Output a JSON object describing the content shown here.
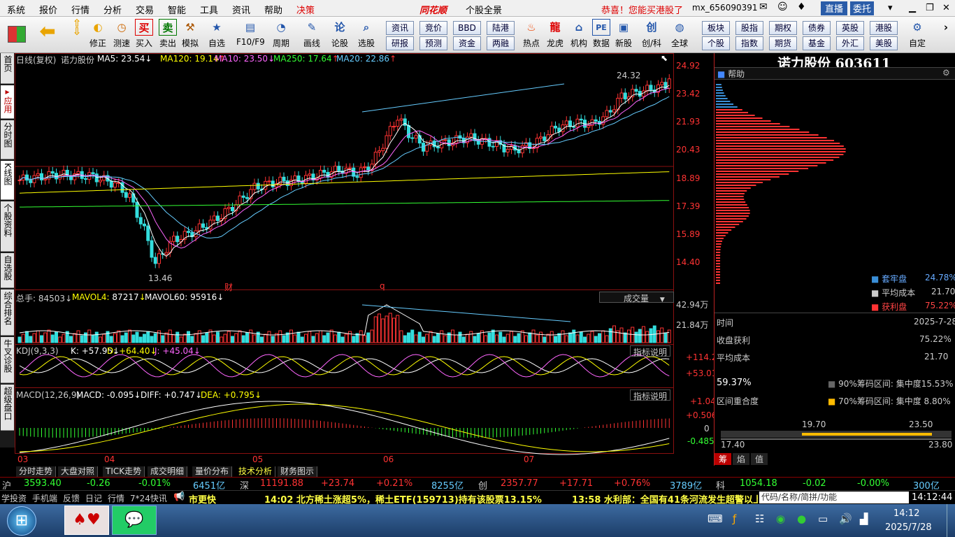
{
  "menu": {
    "items": [
      "系统",
      "报价",
      "行情",
      "分析",
      "交易",
      "智能",
      "工具",
      "资讯",
      "帮助",
      "决策"
    ],
    "brand": "同花顺",
    "sub": "个股全景",
    "promo": "恭喜！您能买港股了",
    "user": "mx_656090391",
    "buttons": [
      "直播",
      "委托"
    ]
  },
  "toolbar": {
    "big": [
      {
        "id": "back",
        "label": ""
      },
      {
        "id": "updown",
        "label": ""
      },
      {
        "id": "fix",
        "label": "修正"
      },
      {
        "id": "speed",
        "label": "测速"
      },
      {
        "id": "buy",
        "label": "买入"
      },
      {
        "id": "sell",
        "label": "卖出"
      },
      {
        "id": "sim",
        "label": "模拟"
      },
      {
        "id": "fav",
        "label": "自选"
      },
      {
        "id": "f10",
        "label": "F10/F9"
      },
      {
        "id": "period",
        "label": "周期"
      },
      {
        "id": "draw",
        "label": "画线"
      },
      {
        "id": "lungu",
        "label": "论股"
      },
      {
        "id": "pick",
        "label": "选股"
      }
    ],
    "grid": [
      [
        "资讯",
        "竞价",
        "BBD",
        "陆港"
      ],
      [
        "研报",
        "预测",
        "资金",
        "两融"
      ]
    ],
    "icons2": [
      {
        "id": "hot",
        "label": "热点"
      },
      {
        "id": "tiger",
        "label": "龙虎"
      },
      {
        "id": "org",
        "label": "机构"
      },
      {
        "id": "data",
        "label": "数据"
      },
      {
        "id": "newstock",
        "label": "新股"
      },
      {
        "id": "chuang",
        "label": "创/科"
      },
      {
        "id": "global",
        "label": "全球"
      }
    ],
    "grid2": [
      [
        "板块",
        "股指",
        "期权",
        "债券",
        "英股",
        "港股"
      ],
      [
        "个股",
        "指数",
        "期货",
        "基金",
        "外汇",
        "美股"
      ]
    ],
    "custom": "自定"
  },
  "sidetabs": [
    "首页",
    "应用",
    "分时图",
    "K线图",
    "个股资料",
    "自选股",
    "综合排名",
    "牛叉诊股",
    "超级盘口"
  ],
  "stock": {
    "title": "诺力股份 603611"
  },
  "chart": {
    "head": {
      "type": "日线(复权)",
      "name": "诺力股份",
      "ma": [
        {
          "k": "MA5",
          "v": "23.54",
          "c": "#ffffff"
        },
        {
          "k": "MA120",
          "v": "19.14",
          "c": "#ffff00"
        },
        {
          "k": "MA10",
          "v": "23.50",
          "c": "#ff66ff"
        },
        {
          "k": "MA250",
          "v": "17.64",
          "c": "#33ff33"
        },
        {
          "k": "MA20",
          "v": "22.86",
          "c": "#66ccff"
        }
      ]
    },
    "yticks": [
      "24.92",
      "23.42",
      "21.93",
      "20.43",
      "18.89",
      "17.39",
      "15.89",
      "14.40"
    ],
    "hi": "24.32",
    "lo": "13.46",
    "marks": [
      "财",
      "q"
    ],
    "vol": {
      "label": "总手",
      "v": "84503",
      "ma4": "87217",
      "ma60": "95916",
      "select": "成交量",
      "ticks": [
        "42.94万",
        "21.84万"
      ]
    },
    "kdj": {
      "name": "KDJ(9,3,3)",
      "k": "+57.95",
      "d": "+64.40",
      "j": "+45.04",
      "help": "指标说明",
      "ticks": [
        "+114.2",
        "+53.01"
      ]
    },
    "macd": {
      "name": "MACD(12,26,9)",
      "macd": "-0.095",
      "diff": "+0.747",
      "dea": "+0.795",
      "help": "指标说明",
      "ticks": [
        "+1.04",
        "+0.506",
        "0",
        "-0.485"
      ]
    },
    "xticks": [
      "03",
      "04",
      "05",
      "06",
      "07"
    ]
  },
  "chart_data": {
    "type": "line",
    "title": "诺力股份 603611",
    "xlabel": "",
    "ylabel": "",
    "x": [
      "03",
      "04",
      "05",
      "06",
      "07"
    ],
    "ylim": [
      13.46,
      24.92
    ],
    "series": [
      {
        "name": "MA5",
        "values": [
          23.54
        ]
      },
      {
        "name": "MA10",
        "values": [
          23.5
        ]
      },
      {
        "name": "MA20",
        "values": [
          22.86
        ]
      },
      {
        "name": "MA120",
        "values": [
          19.14
        ]
      },
      {
        "name": "MA250",
        "values": [
          17.64
        ]
      }
    ]
  },
  "right": {
    "help": "帮助",
    "legend": [
      {
        "k": "套牢盘",
        "v": "24.78%",
        "c": "#3a8fd8"
      },
      {
        "k": "平均成本",
        "v": "21.70",
        "c": "#cccccc"
      },
      {
        "k": "获利盘",
        "v": "75.22%",
        "c": "#ff3333"
      }
    ],
    "rows": [
      {
        "k": "时间",
        "v": "2025-7-28"
      },
      {
        "k": "收盘获利",
        "v": "75.22%"
      },
      {
        "k": "平均成本",
        "v": "21.70"
      }
    ],
    "ratio": "59.37%",
    "overlap": "区间重合度",
    "c90": "90%筹码区间: 集中度15.53%",
    "c70": "70%筹码区间: 集中度 8.80%",
    "r1": [
      "19.70",
      "23.50"
    ],
    "r2": [
      "17.40",
      "23.80"
    ],
    "tabs": [
      "筹",
      "焰",
      "值"
    ]
  },
  "bottomtabs": [
    "分时走势",
    "大盘对照",
    "TICK走势",
    "成交明细",
    "量价分布",
    "技术分析",
    "财务图示"
  ],
  "indexbar": [
    {
      "n": "沪",
      "v": "3593.40",
      "c": "-0.26",
      "p": "-0.01%",
      "a": "6451亿"
    },
    {
      "n": "深",
      "v": "11191.88",
      "c": "+23.74",
      "p": "+0.21%",
      "a": "8255亿"
    },
    {
      "n": "创",
      "v": "2357.77",
      "c": "+17.71",
      "p": "+0.76%",
      "a": "3789亿"
    },
    {
      "n": "科",
      "v": "1054.18",
      "c": "-0.02",
      "p": "-0.00%",
      "a": "300亿"
    }
  ],
  "newsbar": {
    "tabs": [
      "学投资",
      "手机端",
      "反馈",
      "日记",
      "行情",
      "7*24快讯"
    ],
    "update": "市更快",
    "news1": "14:02 北方稀土涨超5%，稀土ETF(159713)持有该股票13.15%",
    "news2": "13:58 水利部：全国有41条河流发生超警以上",
    "search": "代码/名称/简拼/功能",
    "clock": "14:12:44"
  },
  "taskbar": {
    "time": "14:12",
    "date": "2025/7/28"
  }
}
